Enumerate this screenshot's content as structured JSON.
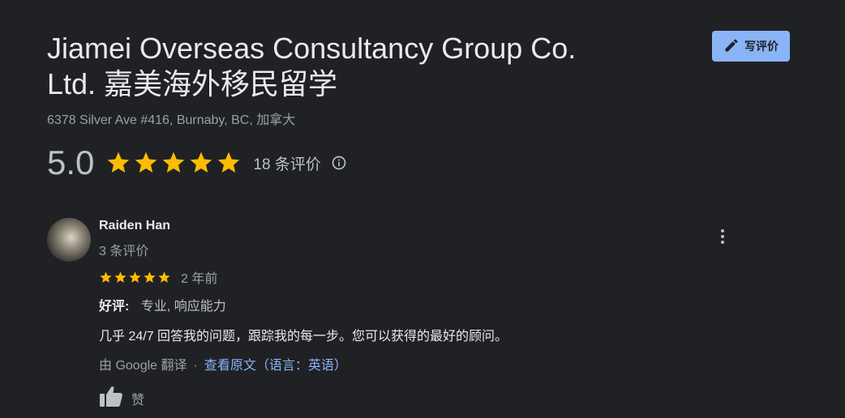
{
  "place": {
    "title": "Jiamei Overseas Consultancy Group Co. Ltd. 嘉美海外移民留学",
    "address": "6378 Silver Ave #416, Burnaby, BC, 加拿大"
  },
  "write_review_button": {
    "label": "写评价",
    "icon": "pencil-icon"
  },
  "rating": {
    "value": "5.0",
    "stars": 5,
    "review_count": "18 条评价"
  },
  "review": {
    "reviewer_name": "Raiden Han",
    "reviewer_review_count": "3 条评价",
    "stars": 5,
    "date": "2 年前",
    "highlights_label": "好评:",
    "highlights_value": "专业, 响应能力",
    "text": "几乎 24/7 回答我的问题，跟踪我的每一步。您可以获得的最好的顾问。",
    "translated_by": "由 Google 翻译",
    "separator": "·",
    "show_original": "查看原文（语言：英语）",
    "like_label": "赞"
  },
  "colors": {
    "background": "#202124",
    "accent": "#8ab4f8",
    "star": "#fbbc04",
    "text_primary": "#e8eaed",
    "text_secondary": "#9aa0a6"
  }
}
